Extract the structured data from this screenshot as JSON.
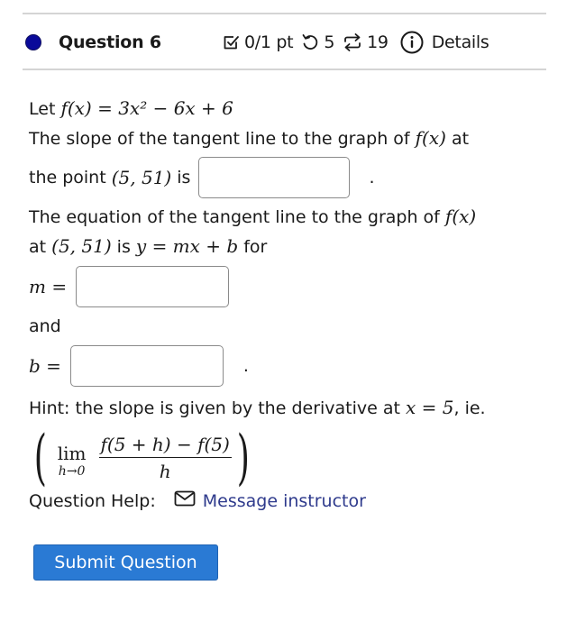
{
  "header": {
    "question_title": "Question 6",
    "status_dot_color": "#0a0a9a",
    "score": "0/1 pt",
    "retries": "5",
    "attempts": "19",
    "details_label": "Details"
  },
  "question": {
    "line1_prefix": "Let ",
    "function_def": "f(x) = 3x² − 6x + 6",
    "line2_prefix": "The slope of the tangent line to the graph of ",
    "fx": "f(x)",
    "line2_suffix": " at",
    "line3_prefix": "the point ",
    "point": "(5, 51)",
    "line3_suffix": " is ",
    "period": ".",
    "line4_prefix": "The equation of the tangent line to the graph of ",
    "line5_prefix": "at ",
    "line5_mid": " is ",
    "line_equation": "y = mx + b",
    "line5_suffix": " for",
    "m_label": "m =",
    "and_label": "and",
    "b_label": "b =",
    "answers": {
      "slope_value": "",
      "m_value": "",
      "b_value": ""
    }
  },
  "hint": {
    "text_prefix": "Hint: the slope is given by the derivative at ",
    "x_eq": "x = 5",
    "text_suffix": ", ie.",
    "open_paren": "(",
    "close_paren": ")",
    "lim": "lim",
    "lim_sub": "h→0",
    "numerator": "f(5 + h) − f(5)",
    "denominator": "h"
  },
  "help": {
    "label": "Question Help:",
    "link_label": "Message instructor",
    "link_color": "#2e3a8c"
  },
  "submit": {
    "label": "Submit Question",
    "color": "#2a7ad4"
  }
}
